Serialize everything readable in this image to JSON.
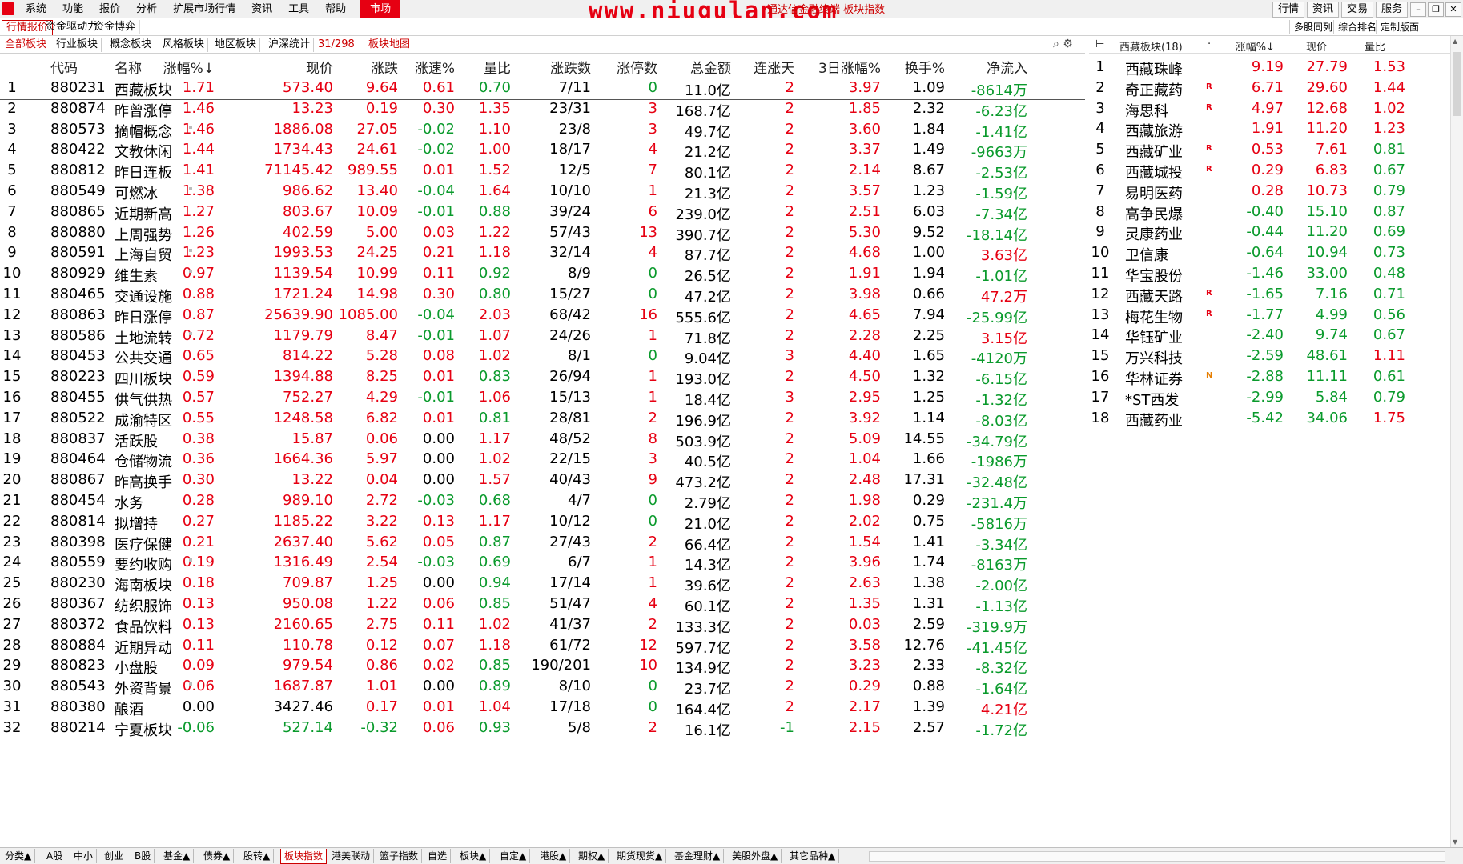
{
  "menubar": {
    "items": [
      "系统",
      "功能",
      "报价",
      "分析",
      "扩展市场行情",
      "资讯",
      "工具",
      "帮助"
    ],
    "active": "市场",
    "watermark": "www.niugulan.com",
    "window_title": "通达信金融终端 板块指数",
    "right_buttons": [
      "行情",
      "资讯",
      "交易",
      "服务"
    ]
  },
  "tabs2": {
    "left": [
      "行情报价",
      "资金驱动力",
      "资金博弈"
    ],
    "right": [
      "多股同列",
      "综合排名",
      "定制版面"
    ]
  },
  "tabs3": {
    "items": [
      "全部板块",
      "行业板块",
      "概念板块",
      "风格板块",
      "地区板块",
      "沪深统计"
    ],
    "count": "31/298",
    "map": "板块地图"
  },
  "table": {
    "headers": [
      "代码",
      "名称",
      "涨幅%↓",
      "现价",
      "涨跌",
      "涨速%",
      "量比",
      "涨跌数",
      "涨停数",
      "总金额",
      "连涨天",
      "3日涨幅%",
      "换手%",
      "净流入"
    ],
    "rows": [
      [
        "1",
        "880231",
        "西藏板块",
        "1.71",
        "573.40",
        "9.64",
        "0.61",
        "0.70",
        "7/11",
        "0",
        "11.0亿",
        "2",
        "3.97",
        "1.09",
        "-8614万"
      ],
      [
        "2",
        "880874",
        "昨曾涨停",
        "1.46",
        "13.23",
        "0.19",
        "0.30",
        "1.35",
        "23/31",
        "3",
        "168.7亿",
        "2",
        "1.85",
        "2.32",
        "-6.23亿"
      ],
      [
        "3",
        "880573",
        "摘帽概念",
        "1.46",
        "1886.08",
        "27.05",
        "-0.02",
        "1.10",
        "23/8",
        "3",
        "49.7亿",
        "2",
        "3.60",
        "1.84",
        "-1.41亿"
      ],
      [
        "4",
        "880422",
        "文教休闲",
        "1.44",
        "1734.43",
        "24.61",
        "-0.02",
        "1.00",
        "18/17",
        "4",
        "21.2亿",
        "2",
        "3.37",
        "1.49",
        "-9663万"
      ],
      [
        "5",
        "880812",
        "昨日连板",
        "1.41",
        "71145.42",
        "989.55",
        "0.01",
        "1.52",
        "12/5",
        "7",
        "80.1亿",
        "2",
        "2.14",
        "8.67",
        "-2.53亿"
      ],
      [
        "6",
        "880549",
        "可燃冰",
        "1.38",
        "986.62",
        "13.40",
        "-0.04",
        "1.64",
        "10/10",
        "1",
        "21.3亿",
        "2",
        "3.57",
        "1.23",
        "-1.59亿"
      ],
      [
        "7",
        "880865",
        "近期新高",
        "1.27",
        "803.67",
        "10.09",
        "-0.01",
        "0.88",
        "39/24",
        "6",
        "239.0亿",
        "2",
        "2.51",
        "6.03",
        "-7.34亿"
      ],
      [
        "8",
        "880880",
        "上周强势",
        "1.26",
        "402.59",
        "5.00",
        "0.03",
        "1.22",
        "57/43",
        "13",
        "390.7亿",
        "2",
        "5.30",
        "9.52",
        "-18.14亿"
      ],
      [
        "9",
        "880591",
        "上海自贸",
        "1.23",
        "1993.53",
        "24.25",
        "0.21",
        "1.18",
        "32/14",
        "4",
        "87.7亿",
        "2",
        "4.68",
        "1.00",
        "3.63亿"
      ],
      [
        "10",
        "880929",
        "维生素",
        "0.97",
        "1139.54",
        "10.99",
        "0.11",
        "0.92",
        "8/9",
        "0",
        "26.5亿",
        "2",
        "1.91",
        "1.94",
        "-1.01亿"
      ],
      [
        "11",
        "880465",
        "交通设施",
        "0.88",
        "1721.24",
        "14.98",
        "0.30",
        "0.80",
        "15/27",
        "0",
        "47.2亿",
        "2",
        "3.98",
        "0.66",
        "47.2万"
      ],
      [
        "12",
        "880863",
        "昨日涨停",
        "0.87",
        "25639.90",
        "1085.00",
        "-0.04",
        "2.03",
        "68/42",
        "16",
        "555.6亿",
        "2",
        "4.65",
        "7.94",
        "-25.99亿"
      ],
      [
        "13",
        "880586",
        "土地流转",
        "0.72",
        "1179.79",
        "8.47",
        "-0.01",
        "1.07",
        "24/26",
        "1",
        "71.8亿",
        "2",
        "2.28",
        "2.25",
        "3.15亿"
      ],
      [
        "14",
        "880453",
        "公共交通",
        "0.65",
        "814.22",
        "5.28",
        "0.08",
        "1.02",
        "8/1",
        "0",
        "9.04亿",
        "3",
        "4.40",
        "1.65",
        "-4120万"
      ],
      [
        "15",
        "880223",
        "四川板块",
        "0.59",
        "1394.88",
        "8.25",
        "0.01",
        "0.83",
        "26/94",
        "1",
        "193.0亿",
        "2",
        "4.50",
        "1.32",
        "-6.15亿"
      ],
      [
        "16",
        "880455",
        "供气供热",
        "0.57",
        "752.27",
        "4.29",
        "-0.01",
        "1.06",
        "15/13",
        "1",
        "18.4亿",
        "3",
        "2.95",
        "1.25",
        "-1.32亿"
      ],
      [
        "17",
        "880522",
        "成渝特区",
        "0.55",
        "1248.58",
        "6.82",
        "0.01",
        "0.81",
        "28/81",
        "2",
        "196.9亿",
        "2",
        "3.92",
        "1.14",
        "-8.03亿"
      ],
      [
        "18",
        "880837",
        "活跃股",
        "0.38",
        "15.87",
        "0.06",
        "0.00",
        "1.17",
        "48/52",
        "8",
        "503.9亿",
        "2",
        "5.09",
        "14.55",
        "-34.79亿"
      ],
      [
        "19",
        "880464",
        "仓储物流",
        "0.36",
        "1664.36",
        "5.97",
        "0.00",
        "1.02",
        "22/15",
        "3",
        "40.5亿",
        "2",
        "1.04",
        "1.66",
        "-1986万"
      ],
      [
        "20",
        "880867",
        "昨高换手",
        "0.30",
        "13.22",
        "0.04",
        "0.00",
        "1.57",
        "40/43",
        "9",
        "473.2亿",
        "2",
        "2.48",
        "17.31",
        "-32.48亿"
      ],
      [
        "21",
        "880454",
        "水务",
        "0.28",
        "989.10",
        "2.72",
        "-0.03",
        "0.68",
        "4/7",
        "0",
        "2.79亿",
        "2",
        "1.98",
        "0.29",
        "-231.4万"
      ],
      [
        "22",
        "880814",
        "拟增持",
        "0.27",
        "1185.22",
        "3.22",
        "0.13",
        "1.17",
        "10/12",
        "0",
        "21.0亿",
        "2",
        "2.02",
        "0.75",
        "-5816万"
      ],
      [
        "23",
        "880398",
        "医疗保健",
        "0.21",
        "2637.40",
        "5.62",
        "0.05",
        "0.87",
        "27/43",
        "2",
        "66.4亿",
        "2",
        "1.54",
        "1.41",
        "-3.34亿"
      ],
      [
        "24",
        "880559",
        "要约收购",
        "0.19",
        "1316.49",
        "2.54",
        "-0.03",
        "0.69",
        "6/7",
        "1",
        "14.3亿",
        "2",
        "3.96",
        "1.74",
        "-8163万"
      ],
      [
        "25",
        "880230",
        "海南板块",
        "0.18",
        "709.87",
        "1.25",
        "0.00",
        "0.94",
        "17/14",
        "1",
        "39.6亿",
        "2",
        "2.63",
        "1.38",
        "-2.00亿"
      ],
      [
        "26",
        "880367",
        "纺织服饰",
        "0.13",
        "950.08",
        "1.22",
        "0.06",
        "0.85",
        "51/47",
        "4",
        "60.1亿",
        "2",
        "1.35",
        "1.31",
        "-1.13亿"
      ],
      [
        "27",
        "880372",
        "食品饮料",
        "0.13",
        "2160.65",
        "2.75",
        "0.11",
        "1.02",
        "41/37",
        "2",
        "133.3亿",
        "2",
        "0.03",
        "2.59",
        "-319.9万"
      ],
      [
        "28",
        "880884",
        "近期异动",
        "0.11",
        "110.78",
        "0.12",
        "0.07",
        "1.18",
        "61/72",
        "12",
        "597.7亿",
        "2",
        "3.58",
        "12.76",
        "-41.45亿"
      ],
      [
        "29",
        "880823",
        "小盘股",
        "0.09",
        "979.54",
        "0.86",
        "0.02",
        "0.85",
        "190/201",
        "10",
        "134.9亿",
        "2",
        "3.23",
        "2.33",
        "-8.32亿"
      ],
      [
        "30",
        "880543",
        "外资背景",
        "0.06",
        "1687.87",
        "1.01",
        "0.00",
        "0.89",
        "8/10",
        "0",
        "23.7亿",
        "2",
        "0.29",
        "0.88",
        "-1.64亿"
      ],
      [
        "31",
        "880380",
        "酿酒",
        "0.00",
        "3427.46",
        "0.17",
        "0.01",
        "1.04",
        "17/18",
        "0",
        "164.4亿",
        "2",
        "2.17",
        "1.39",
        "4.21亿"
      ],
      [
        "32",
        "880214",
        "宁夏板块",
        "-0.06",
        "527.14",
        "-0.32",
        "0.06",
        "0.93",
        "5/8",
        "2",
        "16.1亿",
        "-1",
        "2.15",
        "2.57",
        "-1.72亿"
      ]
    ]
  },
  "side": {
    "title": "西藏板块(18)",
    "headers": [
      "涨幅%↓",
      "现价",
      "量比"
    ],
    "rows": [
      [
        "1",
        "西藏珠峰",
        "",
        "9.19",
        "27.79",
        "1.53"
      ],
      [
        "2",
        "奇正藏药",
        "R",
        "6.71",
        "29.60",
        "1.44"
      ],
      [
        "3",
        "海思科",
        "R",
        "4.97",
        "12.68",
        "1.02"
      ],
      [
        "4",
        "西藏旅游",
        "",
        "1.91",
        "11.20",
        "1.23"
      ],
      [
        "5",
        "西藏矿业",
        "R",
        "0.53",
        "7.61",
        "0.81"
      ],
      [
        "6",
        "西藏城投",
        "R",
        "0.29",
        "6.83",
        "0.67"
      ],
      [
        "7",
        "易明医药",
        "",
        "0.28",
        "10.73",
        "0.79"
      ],
      [
        "8",
        "高争民爆",
        "",
        "-0.40",
        "15.10",
        "0.87"
      ],
      [
        "9",
        "灵康药业",
        "",
        "-0.44",
        "11.20",
        "0.69"
      ],
      [
        "10",
        "卫信康",
        "",
        "-0.64",
        "10.94",
        "0.73"
      ],
      [
        "11",
        "华宝股份",
        "",
        "-1.46",
        "33.00",
        "0.48"
      ],
      [
        "12",
        "西藏天路",
        "R",
        "-1.65",
        "7.16",
        "0.71"
      ],
      [
        "13",
        "梅花生物",
        "R",
        "-1.77",
        "4.99",
        "0.56"
      ],
      [
        "14",
        "华钰矿业",
        "",
        "-2.40",
        "9.74",
        "0.67"
      ],
      [
        "15",
        "万兴科技",
        "",
        "-2.59",
        "48.61",
        "1.11"
      ],
      [
        "16",
        "华林证券",
        "N",
        "-2.88",
        "11.11",
        "0.61"
      ],
      [
        "17",
        "*ST西发",
        "",
        "-2.99",
        "5.84",
        "0.79"
      ],
      [
        "18",
        "西藏药业",
        "",
        "-5.42",
        "34.06",
        "1.75"
      ]
    ]
  },
  "bottom": {
    "tabs": [
      "分类▲",
      "A股",
      "中小",
      "创业",
      "B股",
      "基金▲",
      "债券▲",
      "股转▲",
      "板块指数",
      "港美联动",
      "篮子指数",
      "自选",
      "板块▲",
      "自定▲",
      "港股▲",
      "期权▲",
      "期货现货▲",
      "基金理财▲",
      "美股外盘▲",
      "其它品种▲"
    ],
    "selected": "板块指数"
  },
  "colors": {
    "up": "#e60012",
    "down": "#0a9a2c",
    "accent": "#c00000"
  },
  "icons": [
    "search-icon",
    "gear-icon"
  ]
}
